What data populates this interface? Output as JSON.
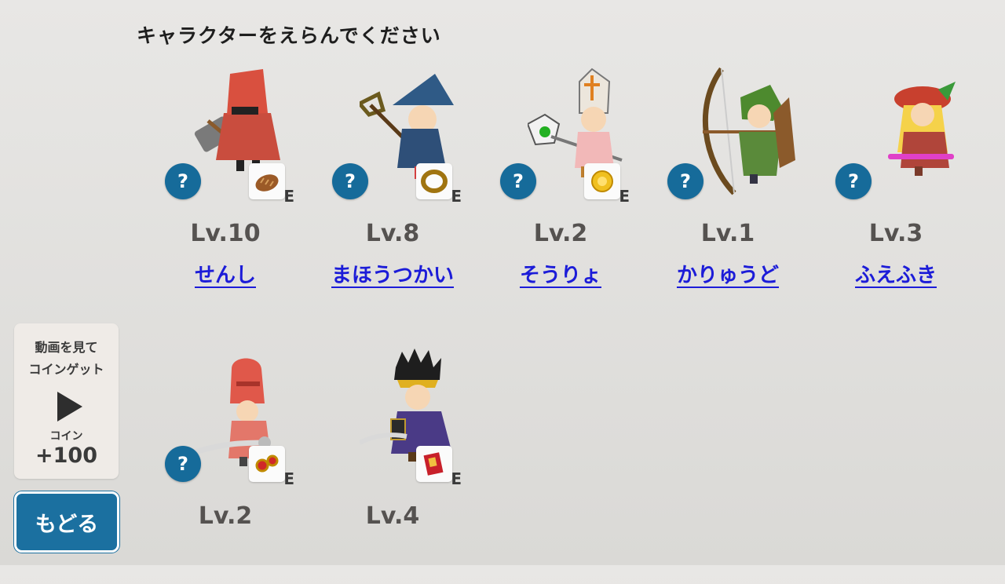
{
  "header": {
    "title": "キャラクターをえらんでください"
  },
  "characters": [
    {
      "level": "Lv.10",
      "name": "せんし",
      "equip_icon": "bread-icon",
      "equip_letter": "E",
      "help": "?"
    },
    {
      "level": "Lv.8",
      "name": "まほうつかい",
      "equip_icon": "ring-icon",
      "equip_letter": "E",
      "help": "?"
    },
    {
      "level": "Lv.2",
      "name": "そうりょ",
      "equip_icon": "gold-coin-icon",
      "equip_letter": "E",
      "help": "?"
    },
    {
      "level": "Lv.1",
      "name": "かりゅうど",
      "help": "?"
    },
    {
      "level": "Lv.3",
      "name": "ふえふき",
      "help": "?"
    },
    {
      "level": "Lv.2",
      "name": "",
      "equip_icon": "earrings-icon",
      "equip_letter": "E",
      "help": "?"
    },
    {
      "level": "Lv.4",
      "name": "",
      "equip_icon": "red-book-icon",
      "equip_letter": "E"
    }
  ],
  "ad_reward": {
    "line1": "動画を見て",
    "line2": "コインゲット",
    "coin_label": "コイン",
    "coin_value": "+100"
  },
  "back_button": {
    "label": "もどる"
  },
  "colors": {
    "link": "#1c1cd8",
    "help_button": "#166b9a",
    "back_button": "#1b70a0"
  }
}
